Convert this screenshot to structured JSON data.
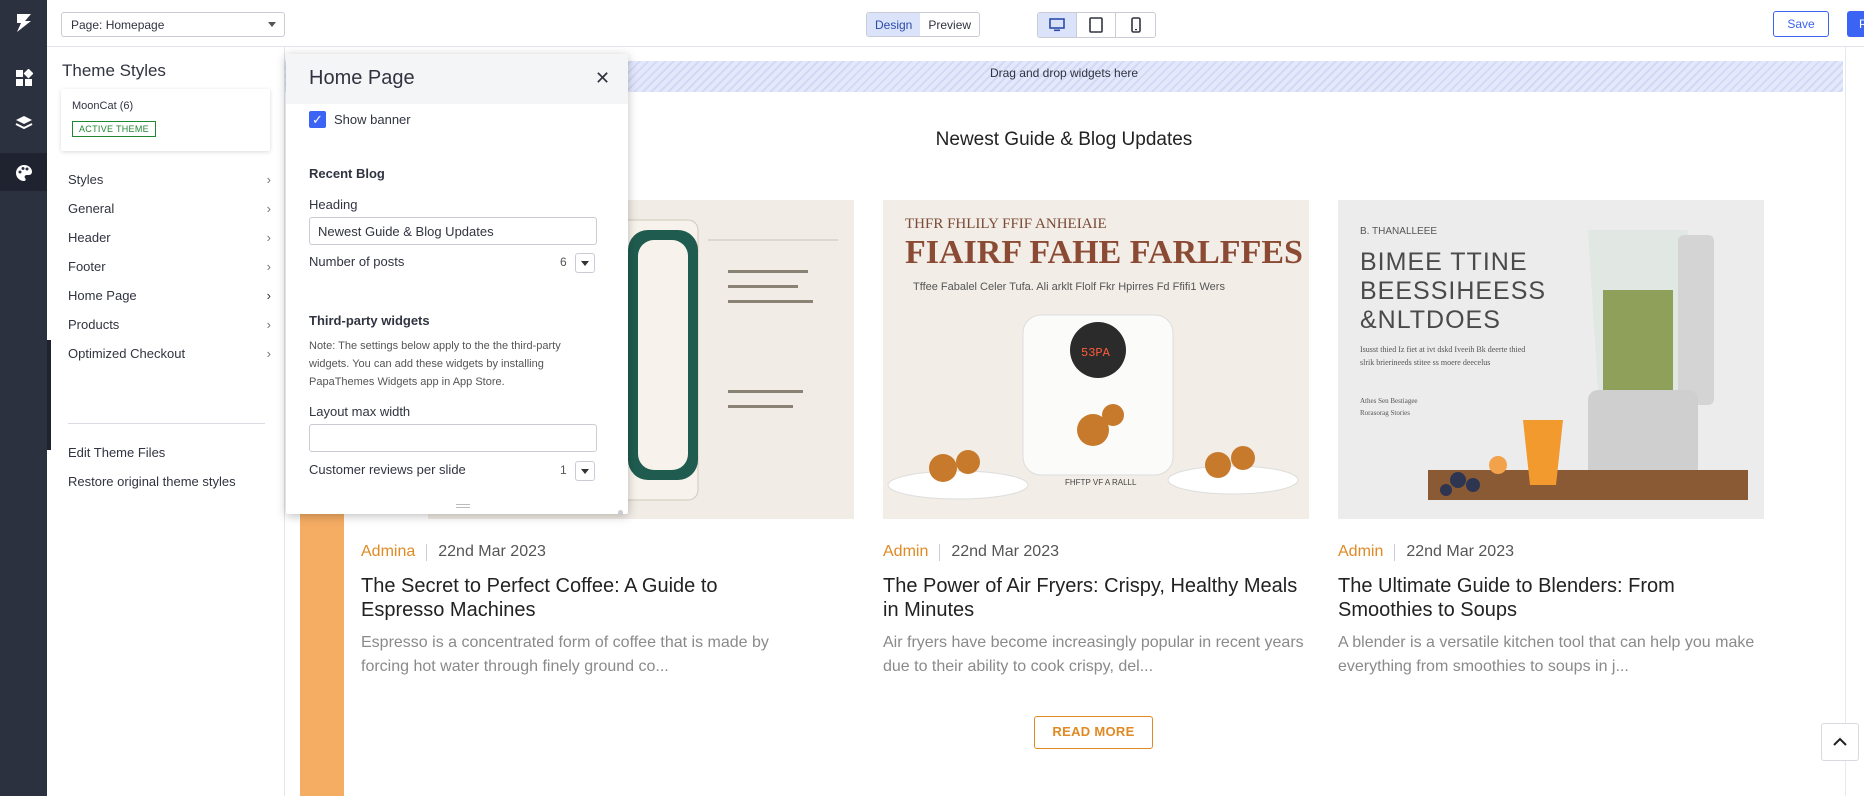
{
  "topbar": {
    "page_select": "Page: Homepage",
    "mode_tabs": [
      "Design",
      "Preview"
    ],
    "save_label": "Save",
    "publish_label": "Pu"
  },
  "sidebar": {
    "title": "Theme Styles",
    "theme_name": "MoonCat (6)",
    "theme_badge": "ACTIVE THEME",
    "items": [
      {
        "label": "Styles"
      },
      {
        "label": "General"
      },
      {
        "label": "Header"
      },
      {
        "label": "Footer"
      },
      {
        "label": "Home Page"
      },
      {
        "label": "Products"
      },
      {
        "label": "Optimized Checkout"
      }
    ],
    "edit_files": "Edit Theme Files",
    "restore": "Restore original theme styles"
  },
  "panel": {
    "title": "Home Page",
    "show_banner": "Show banner",
    "recent_blog": "Recent Blog",
    "heading_label": "Heading",
    "heading_value": "Newest Guide & Blog Updates",
    "posts_label": "Number of posts",
    "posts_value": "6",
    "third_party": "Third-party widgets",
    "note": "Note: The settings below apply to the the third-party widgets. You can add these widgets by installing PapaThemes Widgets app in App Store.",
    "layout_label": "Layout max width",
    "layout_value": "",
    "reviews_label": "Customer reviews per slide",
    "reviews_value": "1"
  },
  "canvas": {
    "dropzone": "Drag and drop widgets here",
    "section_heading": "Newest Guide & Blog Updates",
    "read_more": "READ MORE",
    "posts": [
      {
        "author": "Admina",
        "date": "22nd Mar 2023",
        "title": "The Secret to Perfect Coffee: A Guide to Espresso Machines",
        "excerpt": "Espresso is a concentrated form of coffee that is made by forcing hot water through finely ground co..."
      },
      {
        "author": "Admin",
        "date": "22nd Mar 2023",
        "title": "The Power of Air Fryers: Crispy, Healthy Meals in Minutes",
        "excerpt": "Air fryers have become increasingly popular in recent years due to their ability to cook crispy, del...",
        "image_text": {
          "kicker": "THFR FHLILY FFIF ANHEIAIE",
          "headline": "FIAIRF FAHE FARLFFES",
          "sub": "Tffee Fabalel Celer Tufa. Ali arklt Flolf Fkr Hpirres Fd Ffifi1 Wers",
          "display": "53PA",
          "caption": "FHFTP VF A RALLL"
        }
      },
      {
        "author": "Admin",
        "date": "22nd Mar 2023",
        "title": "The Ultimate Guide to Blenders: From Smoothies to Soups",
        "excerpt": "A blender is a versatile kitchen tool that can help you make everything from smoothies to soups in j...",
        "image_text": {
          "kicker": "B. THANALLEEE",
          "headline": "BIMEE TTINE BEESSIHEESS &NLTDOES",
          "body": "Isusst thied Iz fiet at ivt dskd Iveeih Bk deerte thied slrik brierineeds stitee ss moere deecelus",
          "foot1": "Athes Sen Bestiagee",
          "foot2": "Rorasorag Stories"
        }
      }
    ]
  }
}
